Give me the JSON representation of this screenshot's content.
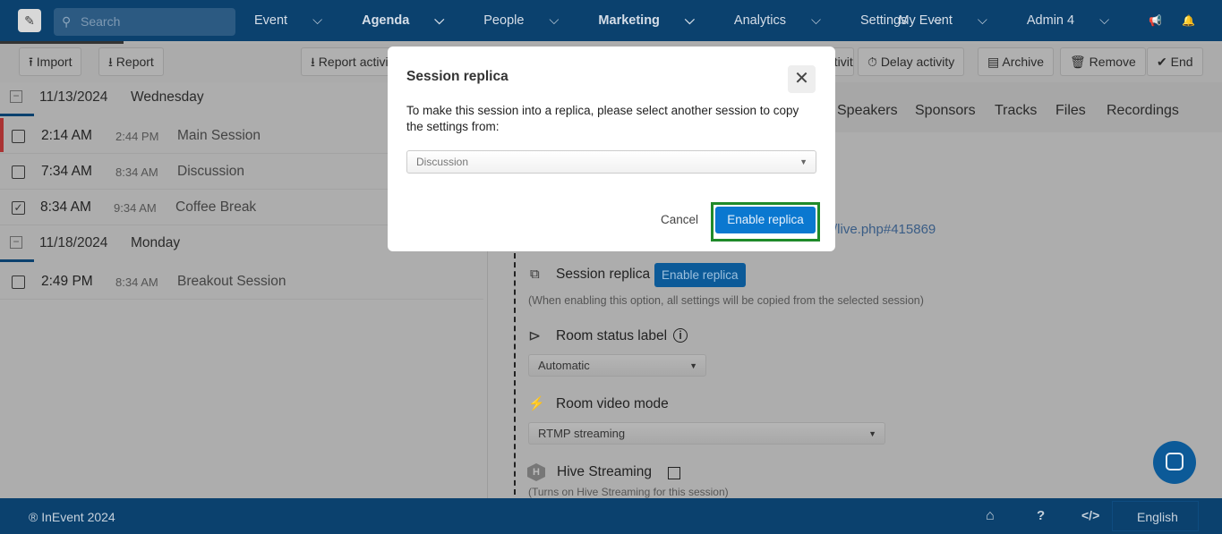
{
  "topbar": {
    "search_placeholder": "Search",
    "nav": [
      "Event",
      "Agenda",
      "People",
      "Marketing",
      "Analytics",
      "Settings"
    ],
    "my_event": "My Event",
    "admin": "Admin 4"
  },
  "toolbar": {
    "import": "Import",
    "report": "Report",
    "report_activity": "Report activity",
    "activity_partial": "activity",
    "delay": "Delay activity",
    "archive": "Archive",
    "remove": "Remove",
    "end": "End"
  },
  "days": [
    {
      "date": "11/13/2024",
      "weekday": "Wednesday",
      "sessions": [
        {
          "start": "2:14 AM",
          "end": "2:44 PM",
          "name": "Main Session",
          "checked": false
        },
        {
          "start": "7:34 AM",
          "end": "8:34 AM",
          "name": "Discussion",
          "checked": false
        },
        {
          "start": "8:34 AM",
          "end": "9:34 AM",
          "name": "Coffee Break",
          "checked": true
        }
      ]
    },
    {
      "date": "11/18/2024",
      "weekday": "Monday",
      "sessions": [
        {
          "start": "2:49 PM",
          "end": "8:34 AM",
          "name": "Breakout Session",
          "checked": false
        }
      ]
    }
  ],
  "tabs": [
    "Speakers",
    "Sponsors",
    "Tracks",
    "Files",
    "Recordings"
  ],
  "content": {
    "link": "/live.php#415869",
    "replica_label": "Session replica",
    "replica_button": "Enable replica",
    "replica_note": "(When enabling this option, all settings will be copied from the selected session)",
    "status_label": "Room status label",
    "status_value": "Automatic",
    "video_label": "Room video mode",
    "video_value": "RTMP streaming",
    "hive_label": "Hive Streaming",
    "hive_note": "(Turns on Hive Streaming for this session)"
  },
  "modal": {
    "title": "Session replica",
    "body": "To make this session into a replica, please select another session to copy the settings from:",
    "select_value": "Discussion",
    "cancel": "Cancel",
    "confirm": "Enable replica"
  },
  "footer": {
    "copyright": "® InEvent 2024",
    "language": "English"
  },
  "colors": {
    "brand": "#0b416e",
    "primary": "#0a78d0",
    "highlight": "#1f8a2a"
  }
}
